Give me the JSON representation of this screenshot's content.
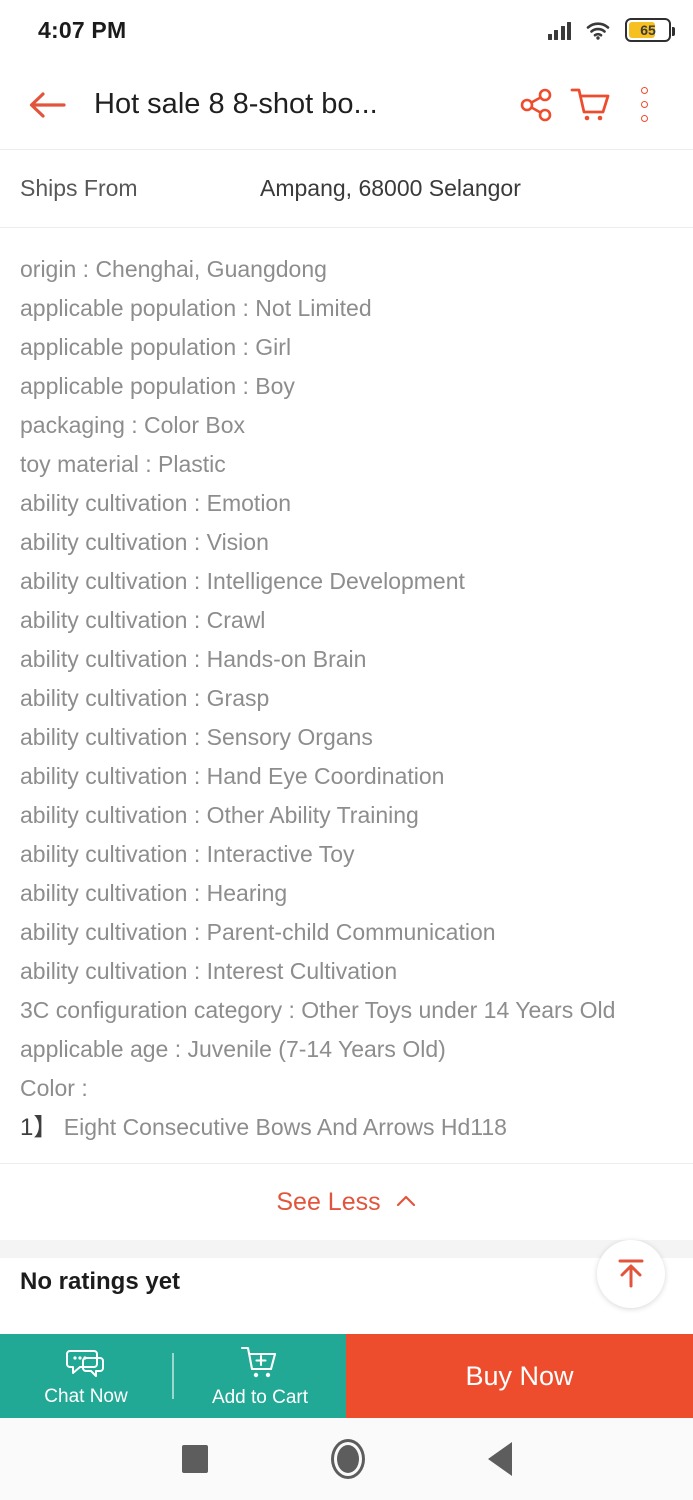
{
  "status_bar": {
    "time": "4:07 PM",
    "battery_level": "65",
    "icons": [
      "signal-icon",
      "wifi-icon",
      "battery-icon"
    ]
  },
  "header": {
    "back_icon": "back-arrow-icon",
    "title": "Hot sale 8 8-shot bo...",
    "share_icon": "share-icon",
    "cart_icon": "cart-icon",
    "more_icon": "more-options-icon"
  },
  "shipping": {
    "label": "Ships From",
    "value": "Ampang, 68000 Selangor"
  },
  "specs": [
    {
      "key": "origin",
      "sep": " : ",
      "value": "Chenghai, Guangdong"
    },
    {
      "key": "applicable population",
      "sep": " : ",
      "value": "Not Limited"
    },
    {
      "key": "applicable population",
      "sep": " : ",
      "value": "Girl"
    },
    {
      "key": "applicable population",
      "sep": " : ",
      "value": "Boy"
    },
    {
      "key": "packaging",
      "sep": " : ",
      "value": "Color Box"
    },
    {
      "key": "toy material",
      "sep": " : ",
      "value": "Plastic"
    },
    {
      "key": "ability cultivation",
      "sep": " : ",
      "value": "Emotion"
    },
    {
      "key": "ability cultivation",
      "sep": " : ",
      "value": "Vision"
    },
    {
      "key": "ability cultivation",
      "sep": " : ",
      "value": "Intelligence Development"
    },
    {
      "key": "ability cultivation",
      "sep": " : ",
      "value": "Crawl"
    },
    {
      "key": "ability cultivation",
      "sep": " : ",
      "value": "Hands-on Brain"
    },
    {
      "key": "ability cultivation",
      "sep": " : ",
      "value": "Grasp"
    },
    {
      "key": "ability cultivation",
      "sep": " : ",
      "value": "Sensory Organs"
    },
    {
      "key": "ability cultivation",
      "sep": " : ",
      "value": "Hand Eye Coordination"
    },
    {
      "key": "ability cultivation",
      "sep": " : ",
      "value": "Other Ability Training"
    },
    {
      "key": "ability cultivation",
      "sep": " : ",
      "value": "Interactive Toy"
    },
    {
      "key": "ability cultivation",
      "sep": " : ",
      "value": "Hearing"
    },
    {
      "key": "ability cultivation",
      "sep": " : ",
      "value": "Parent-child Communication"
    },
    {
      "key": "ability cultivation",
      "sep": " : ",
      "value": "Interest Cultivation"
    },
    {
      "key": "3C configuration category",
      "sep": " : ",
      "value": "Other Toys under 14 Years Old"
    },
    {
      "key": "applicable age",
      "sep": " : ",
      "value": "Juvenile (7-14 Years Old)"
    },
    {
      "key": "Color",
      "sep": " :",
      "value": ""
    }
  ],
  "color_options": [
    {
      "index": "1】",
      "label": "Eight Consecutive Bows And Arrows Hd118"
    }
  ],
  "see_less": {
    "label": "See Less",
    "icon": "chevron-up-icon"
  },
  "ratings": {
    "text": "No ratings yet"
  },
  "scroll_top": {
    "icon": "scroll-to-top-icon"
  },
  "action_bar": {
    "chat": {
      "label": "Chat Now",
      "icon": "chat-bubble-icon"
    },
    "add_to_cart": {
      "label": "Add to Cart",
      "icon": "cart-plus-icon"
    },
    "buy_now": {
      "label": "Buy Now"
    }
  },
  "nav_bar": {
    "recents_icon": "square-recents-icon",
    "home_icon": "circle-home-icon",
    "back_icon": "triangle-back-icon"
  },
  "colors": {
    "accent_orange": "#ee4d2d",
    "teal": "#22a996",
    "text_grey": "#8d8d8d",
    "battery_amber": "#f6c020"
  }
}
